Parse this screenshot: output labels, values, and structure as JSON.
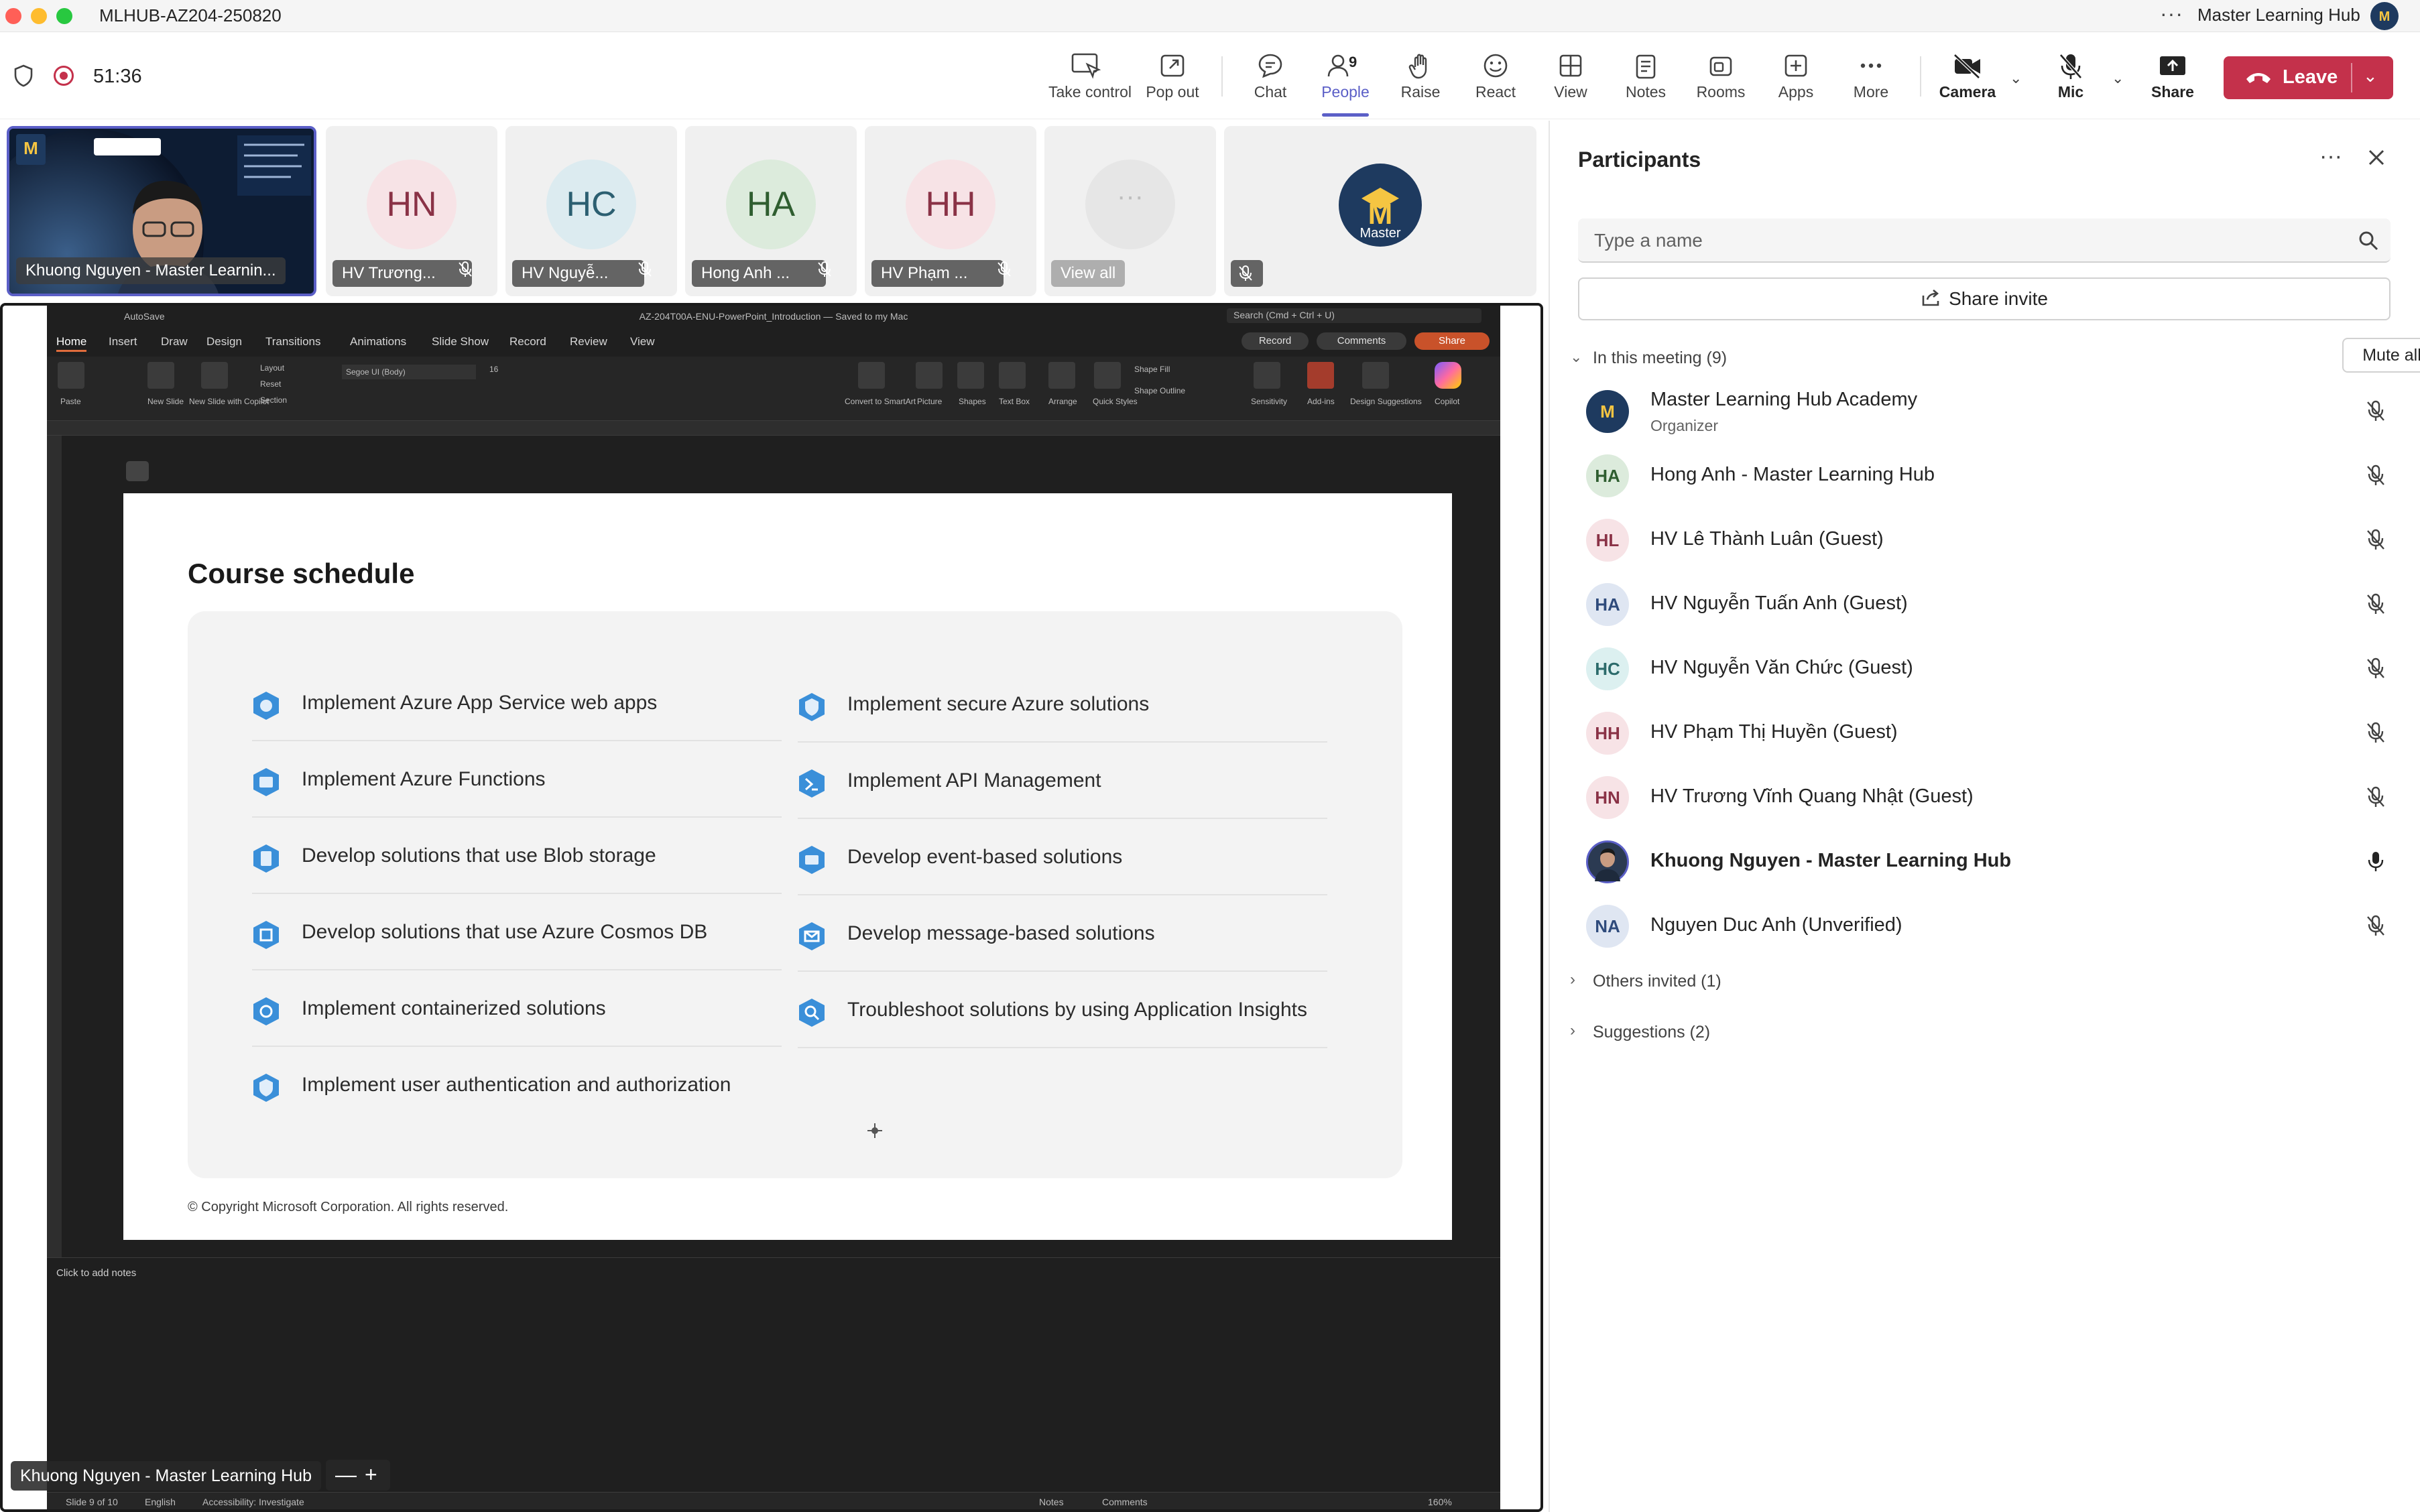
{
  "window": {
    "title": "MLHUB-AZ204-250820",
    "more": "···",
    "org_name": "Master Learning Hub"
  },
  "toolbar": {
    "timer": "51:36",
    "buttons": {
      "take_control": "Take control",
      "pop_out": "Pop out",
      "chat": "Chat",
      "people": "People",
      "people_count": "9",
      "raise": "Raise",
      "react": "React",
      "view": "View",
      "notes": "Notes",
      "rooms": "Rooms",
      "apps": "Apps",
      "more": "More",
      "camera": "Camera",
      "mic": "Mic",
      "share": "Share",
      "leave": "Leave"
    }
  },
  "video_strip": {
    "speaker_label": "Khuong Nguyen - Master Learnin...",
    "tiles": [
      {
        "initials": "HN",
        "label": "HV Trương...",
        "bg": "#f7e3e6",
        "fg": "#8a3246"
      },
      {
        "initials": "HC",
        "label": "HV Nguyễ...",
        "bg": "#dcebf0",
        "fg": "#2c5f71"
      },
      {
        "initials": "HA",
        "label": "Hong Anh ...",
        "bg": "#dcebdc",
        "fg": "#2f5e30"
      },
      {
        "initials": "HH",
        "label": "HV Phạm ...",
        "bg": "#f7e3e6",
        "fg": "#8a3246"
      }
    ],
    "view_all": "View all"
  },
  "shared_screen": {
    "ppt_title": "AZ-204T00A-ENU-PowerPoint_Introduction — Saved to my Mac",
    "autosave": "AutoSave",
    "search": "Search (Cmd + Ctrl + U)",
    "tabs": [
      "Home",
      "Insert",
      "Draw",
      "Design",
      "Transitions",
      "Animations",
      "Slide Show",
      "Record",
      "Review",
      "View"
    ],
    "pills": {
      "record": "Record",
      "comments": "Comments",
      "share": "Share"
    },
    "ribbon_labels": [
      "Paste",
      "New Slide",
      "New Slide with Copilot",
      "Layout",
      "Reset",
      "Section",
      "Segoe UI (Body)",
      "16",
      "Convert to SmartArt",
      "Picture",
      "Shapes",
      "Text Box",
      "Arrange",
      "Quick Styles",
      "Shape Fill",
      "Shape Outline",
      "Sensitivity",
      "Add-ins",
      "Design Suggestions",
      "Copilot"
    ],
    "slide": {
      "heading": "Course schedule",
      "left_items": [
        "Implement Azure App Service web apps",
        "Implement Azure Functions",
        "Develop solutions that use Blob storage",
        "Develop solutions that use Azure Cosmos DB",
        "Implement containerized solutions",
        "Implement user authentication and authorization"
      ],
      "right_items": [
        "Implement secure Azure solutions",
        "Implement API Management",
        "Develop event-based solutions",
        "Develop message-based solutions",
        "Troubleshoot solutions by using Application Insights"
      ],
      "copyright": "© Copyright Microsoft Corporation. All rights reserved."
    },
    "notes_placeholder": "Click to add notes",
    "status": {
      "slide": "Slide 9 of 10",
      "language": "English",
      "accessibility": "Accessibility: Investigate",
      "notes": "Notes",
      "comments": "Comments",
      "zoom": "160%"
    },
    "presenter_label": "Khuong Nguyen - Master Learning Hub",
    "presenter_minus": "—",
    "presenter_plus": "+"
  },
  "participants": {
    "title": "Participants",
    "search_placeholder": "Type a name",
    "share_invite": "Share invite",
    "in_meeting": "In this meeting (9)",
    "mute_all": "Mute all",
    "people": [
      {
        "name": "Master Learning Hub Academy",
        "role": "Organizer",
        "initials": "M",
        "bg": "#1e3a5f",
        "fg": "#f5c542",
        "muted": true
      },
      {
        "name": "Hong Anh - Master Learning Hub",
        "role": "",
        "initials": "HA",
        "bg": "#dcebdc",
        "fg": "#2f5e30",
        "muted": true
      },
      {
        "name": "HV Lê Thành Luân (Guest)",
        "role": "",
        "initials": "HL",
        "bg": "#f7e3e6",
        "fg": "#8a3246",
        "muted": true
      },
      {
        "name": "HV Nguyễn Tuấn Anh (Guest)",
        "role": "",
        "initials": "HA",
        "bg": "#dfe6f2",
        "fg": "#2f4b7c",
        "muted": true
      },
      {
        "name": "HV Nguyễn Văn Chức (Guest)",
        "role": "",
        "initials": "HC",
        "bg": "#dcf0f0",
        "fg": "#2c6b6b",
        "muted": true
      },
      {
        "name": "HV Phạm Thị Huyền (Guest)",
        "role": "",
        "initials": "HH",
        "bg": "#f7e3e6",
        "fg": "#8a3246",
        "muted": true
      },
      {
        "name": "HV Trương Vĩnh Quang Nhật (Guest)",
        "role": "",
        "initials": "HN",
        "bg": "#f7e3e6",
        "fg": "#8a3246",
        "muted": true
      },
      {
        "name": "Khuong Nguyen - Master Learning Hub",
        "role": "",
        "initials": "",
        "bg": "#2b3a52",
        "fg": "#ffffff",
        "muted": false
      },
      {
        "name": "Nguyen Duc Anh (Unverified)",
        "role": "",
        "initials": "NA",
        "bg": "#dfe6f2",
        "fg": "#2f4b7c",
        "muted": true
      }
    ],
    "others_invited": "Others invited (1)",
    "suggestions": "Suggestions (2)"
  },
  "colors": {
    "accent": "#5b5fc7",
    "leave": "#c4314b",
    "recording": "#c4314b"
  }
}
